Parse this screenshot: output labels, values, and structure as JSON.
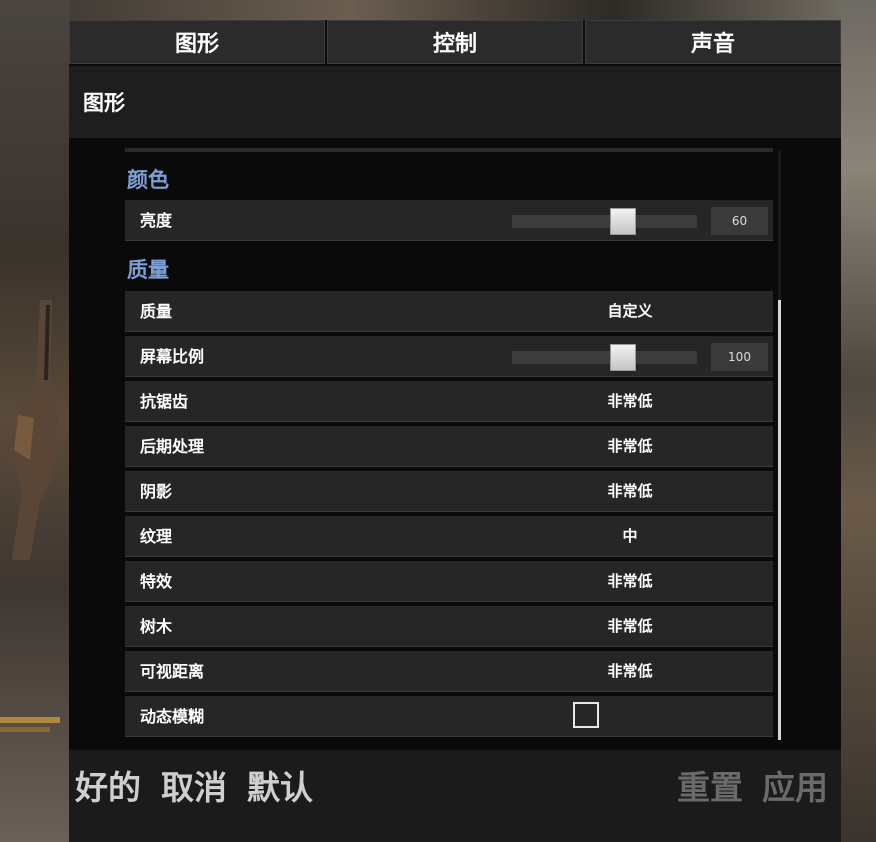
{
  "tabs": [
    {
      "label": "图形"
    },
    {
      "label": "控制"
    },
    {
      "label": "声音"
    }
  ],
  "section_title": "图形",
  "groups": {
    "color": {
      "title": "颜色"
    },
    "quality": {
      "title": "质量"
    }
  },
  "settings": {
    "brightness": {
      "label": "亮度",
      "value": "60",
      "slider_fraction": 0.6
    },
    "quality": {
      "label": "质量",
      "value": "自定义"
    },
    "screen_scale": {
      "label": "屏幕比例",
      "value": "100",
      "slider_fraction": 0.6
    },
    "anti_aliasing": {
      "label": "抗锯齿",
      "value": "非常低"
    },
    "post_processing": {
      "label": "后期处理",
      "value": "非常低"
    },
    "shadows": {
      "label": "阴影",
      "value": "非常低"
    },
    "textures": {
      "label": "纹理",
      "value": "中"
    },
    "effects": {
      "label": "特效",
      "value": "非常低"
    },
    "foliage": {
      "label": "树木",
      "value": "非常低"
    },
    "view_distance": {
      "label": "可视距离",
      "value": "非常低"
    },
    "motion_blur": {
      "label": "动态模糊",
      "checked": false
    }
  },
  "footer": {
    "ok": "好的",
    "cancel": "取消",
    "default": "默认",
    "reset": "重置",
    "apply": "应用"
  },
  "colors": {
    "group_title": "#7c9fd4",
    "row_bg": "#262626",
    "disabled_button": "#6a6a6a"
  }
}
